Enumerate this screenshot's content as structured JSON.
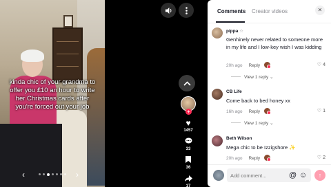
{
  "video": {
    "caption": "kinda chic of your grandma to offer you £10 an hour to write her Christmas cards after you're forced out your job",
    "prev_icon": "chevron-left-icon",
    "next_icon": "chevron-right-icon"
  },
  "controls": {
    "volume_icon": "volume-icon",
    "more_icon": "more-vertical-icon",
    "up_icon": "chevron-up-icon"
  },
  "actions": {
    "likes": "1457",
    "comments": "33",
    "saves": "36",
    "shares": "17"
  },
  "panel": {
    "tabs": [
      {
        "label": "Comments"
      },
      {
        "label": "Creator videos"
      }
    ],
    "close_label": "✕"
  },
  "comments": [
    {
      "user": "pippa",
      "user_badge": "☆",
      "text": "Genhinely never related to someone more in my life and I low-key wish I was kidding",
      "time": "20h ago",
      "reply": "Reply",
      "likes": "4",
      "view_replies": "View 1 reply",
      "avatar_color": "#b49a7c"
    },
    {
      "user": "CB Life",
      "text": "Come back to bed honey xx",
      "time": "16h ago",
      "reply": "Reply",
      "likes": "1",
      "view_replies": "View 1 reply",
      "avatar_color": "#6a4a3c"
    },
    {
      "user": "Beth Wilson",
      "text": "Mega chic to be Izzigshore ✨",
      "time": "20h ago",
      "reply": "Reply",
      "likes": "2",
      "avatar_color": "#7b4a52"
    }
  ],
  "composer": {
    "placeholder": "Add comment...",
    "mention_label": "@",
    "emoji_label": "☺",
    "send_label": "↑"
  }
}
